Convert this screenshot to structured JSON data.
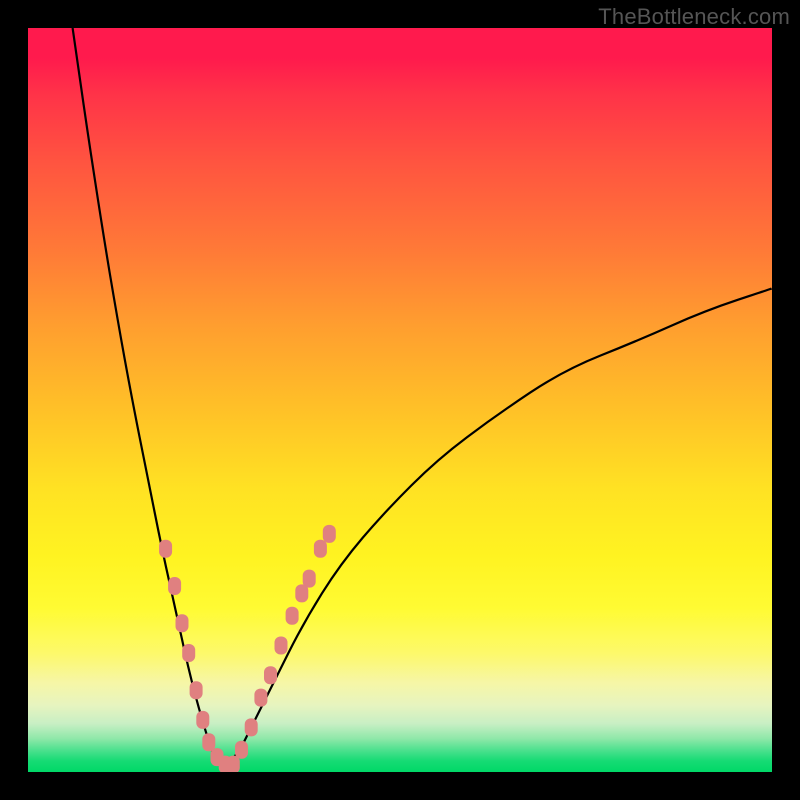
{
  "watermark": "TheBottleneck.com",
  "colors": {
    "frame": "#000000",
    "curve": "#000000",
    "marker_fill": "#e08080",
    "marker_stroke": "#c76e6e"
  },
  "chart_data": {
    "type": "line",
    "title": "",
    "xlabel": "",
    "ylabel": "",
    "xlim": [
      0,
      100
    ],
    "ylim": [
      0,
      100
    ],
    "grid": false,
    "legend": false,
    "note": "Axes are unlabeled; x interpreted as horizontal position 0–100, y as vertical value 0–100 (0 at bottom). Curve minimum near x≈25 reaching y≈0; rises steeply to the left reaching y≈100 near x≈6 and rises more gently to the right reaching y≈65 at x=100.",
    "series": [
      {
        "name": "curve",
        "x": [
          6,
          8,
          10,
          12,
          14,
          16,
          18,
          20,
          22,
          24,
          25,
          26,
          28,
          30,
          33,
          37,
          42,
          48,
          55,
          63,
          72,
          82,
          91,
          100
        ],
        "y": [
          100,
          86,
          73,
          61,
          50,
          40,
          30,
          21,
          12,
          5,
          2,
          1,
          2,
          6,
          12,
          20,
          28,
          35,
          42,
          48,
          54,
          58,
          62,
          65
        ]
      }
    ],
    "markers": {
      "comment": "Pink rounded markers clustered along the curve near the valley; one pair on the right flank.",
      "points": [
        {
          "x": 18.5,
          "y": 30
        },
        {
          "x": 19.7,
          "y": 25
        },
        {
          "x": 20.7,
          "y": 20
        },
        {
          "x": 21.6,
          "y": 16
        },
        {
          "x": 22.6,
          "y": 11
        },
        {
          "x": 23.5,
          "y": 7
        },
        {
          "x": 24.3,
          "y": 4
        },
        {
          "x": 25.4,
          "y": 2
        },
        {
          "x": 26.5,
          "y": 1
        },
        {
          "x": 27.6,
          "y": 1
        },
        {
          "x": 28.7,
          "y": 3
        },
        {
          "x": 30.0,
          "y": 6
        },
        {
          "x": 31.3,
          "y": 10
        },
        {
          "x": 32.6,
          "y": 13
        },
        {
          "x": 34.0,
          "y": 17
        },
        {
          "x": 35.5,
          "y": 21
        },
        {
          "x": 36.8,
          "y": 24
        },
        {
          "x": 37.8,
          "y": 26
        },
        {
          "x": 39.3,
          "y": 30
        },
        {
          "x": 40.5,
          "y": 32
        }
      ]
    }
  }
}
